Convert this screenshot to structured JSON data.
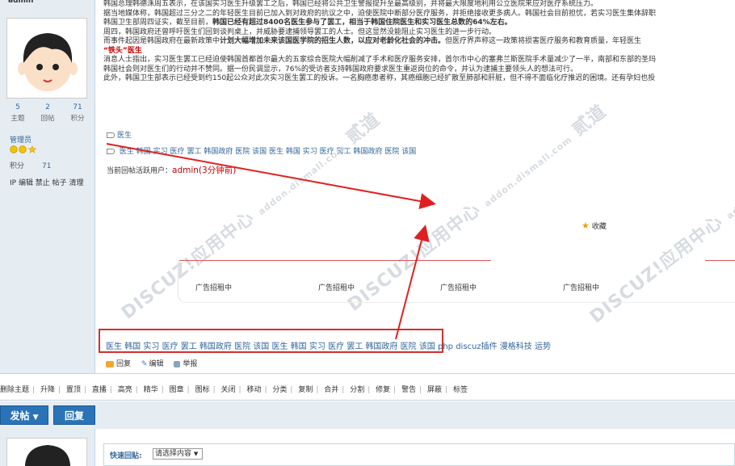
{
  "user": {
    "name": "admin",
    "stats": [
      {
        "num": "5",
        "label": "主题"
      },
      {
        "num": "2",
        "label": "回帖"
      },
      {
        "num": "71",
        "label": "积分"
      }
    ],
    "group": "管理员",
    "points_label": "积分",
    "points_value": "71",
    "admin_links": "IP 编辑 禁止 帖子 清理"
  },
  "article": {
    "lines": [
      "韩国总理韩德洙周五表示，在该国实习医生升级罢工之后，韩国已经将公共卫生警报提升至最高级别，并将最大限度地利用公立医院来应对医疗系统压力。",
      "据当地媒体称，韩国超过三分之二的年轻医生目前已加入到对政府的抗议之中，迫使医院中断部分医疗服务，并拒绝接收更多病人。韩国社会目前担忧，若实习医生集体辞职",
      "韩国卫生部周四证实，截至目前，",
      "周四，韩国政府还曾呼吁医生们回到谈判桌上，并威胁要逮捕领导罢工的人士。但这显然没能阻止实习医生的进一步行动。",
      "而事件起因是韩国政府在最新政策中",
      "消息人士指出，实习医生罢工已经迫使韩国首都首尔最大的五家综合医院大幅削减了手术和医疗服务安排，首尔市中心的塞弗兰斯医院手术量减少了一半，南部和东部的圣玛",
      "韩国社会则对医生们的行动并不赞同。据一份民调显示，76%的受访者支持韩国政府要求医生重返岗位的命令，并认为逮捕主要领头人的想法可行。",
      "此外，韩国卫生部表示已经受到约150起公众对此次实习医生罢工的投诉。一名胸癌患者称，其癌细胞已经扩散至肺部和肝脏，但不得不面临化疗推迟的困境。还有孕妇也投"
    ],
    "line3_bold": "韩国已经有超过8400名医生参与了罢工，相当于韩国住院医生和实习医生总数的64%左右。",
    "line5_bold": "计划大幅增加未来该国医学院的招生人数，以应对老龄化社会的冲击。",
    "line5_tail": "但医疗界声称这一政策将损害医疗服务和教育质量，年轻医生",
    "line6_red": "“铁头”医生"
  },
  "tags_line1": "医生",
  "tags_line2": [
    "医生",
    "韩国",
    "实习",
    "医疗",
    "罢工",
    "韩国政府",
    "医院",
    "该国",
    "医生",
    "韩国",
    "实习",
    "医疗",
    "罢工",
    "韩国政府",
    "医院",
    "该国"
  ],
  "reply_users": {
    "label": "当前回帖活跃用户：",
    "user": "admin(3分钟前)"
  },
  "favorite_label": "收藏",
  "watermark": {
    "main": "DISCUZ!应用中心",
    "sub": "addon.dismall.com",
    "extra": "贰道"
  },
  "ads": [
    "广告招租中",
    "广告招租中",
    "广告招租中",
    "广告招租中"
  ],
  "tags_row": [
    "医生",
    "韩国",
    "实习",
    "医疗",
    "罢工",
    "韩国政府",
    "医院",
    "该国",
    "医生",
    "韩国",
    "实习",
    "医疗",
    "罢工",
    "韩国政府",
    "医院",
    "该国"
  ],
  "tags_extra": "php discuz插件 漫格科技 运势",
  "actions": {
    "reply": "回复",
    "edit": "编辑",
    "report": "举报"
  },
  "mod_links": [
    "删除主题",
    "升降",
    "置顶",
    "直播",
    "高亮",
    "精华",
    "图章",
    "图标",
    "关闭",
    "移动",
    "分类",
    "复制",
    "合并",
    "分割",
    "修复",
    "警告",
    "屏蔽",
    "标签"
  ],
  "buttons": {
    "post": "发帖",
    "reply": "回复"
  },
  "quick_reply": {
    "label": "快速回贴:",
    "select": "请选择内容"
  }
}
